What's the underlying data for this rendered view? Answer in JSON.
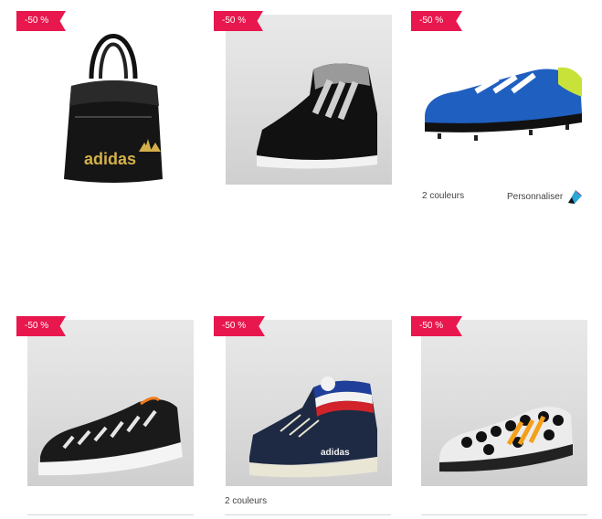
{
  "products": [
    {
      "id": "bag",
      "badge": "-50 %",
      "image_alt": "adidas originals black shoulder bag"
    },
    {
      "id": "sneaker-high-black",
      "badge": "-50 %",
      "image_alt": "black high-top sneaker with silver stripes"
    },
    {
      "id": "football-boot-blue",
      "badge": "-50 %",
      "image_alt": "blue football boot with yellow details",
      "colors_text": "2 couleurs",
      "personalize_text": "Personnaliser"
    },
    {
      "id": "running-shoe-print",
      "badge": "-50 %",
      "image_alt": "black and white patterned running shoe"
    },
    {
      "id": "sneaker-high-navy",
      "badge": "-50 %",
      "image_alt": "navy high-top sneaker with tricolor collar",
      "colors_text": "2 couleurs"
    },
    {
      "id": "football-boot-worldcup",
      "badge": "-50 %",
      "image_alt": "black and white patterned football boot"
    }
  ],
  "brand_text": "adidas",
  "colors": {
    "badge": "#e8174e",
    "badge_fold": "#9e0d33"
  }
}
